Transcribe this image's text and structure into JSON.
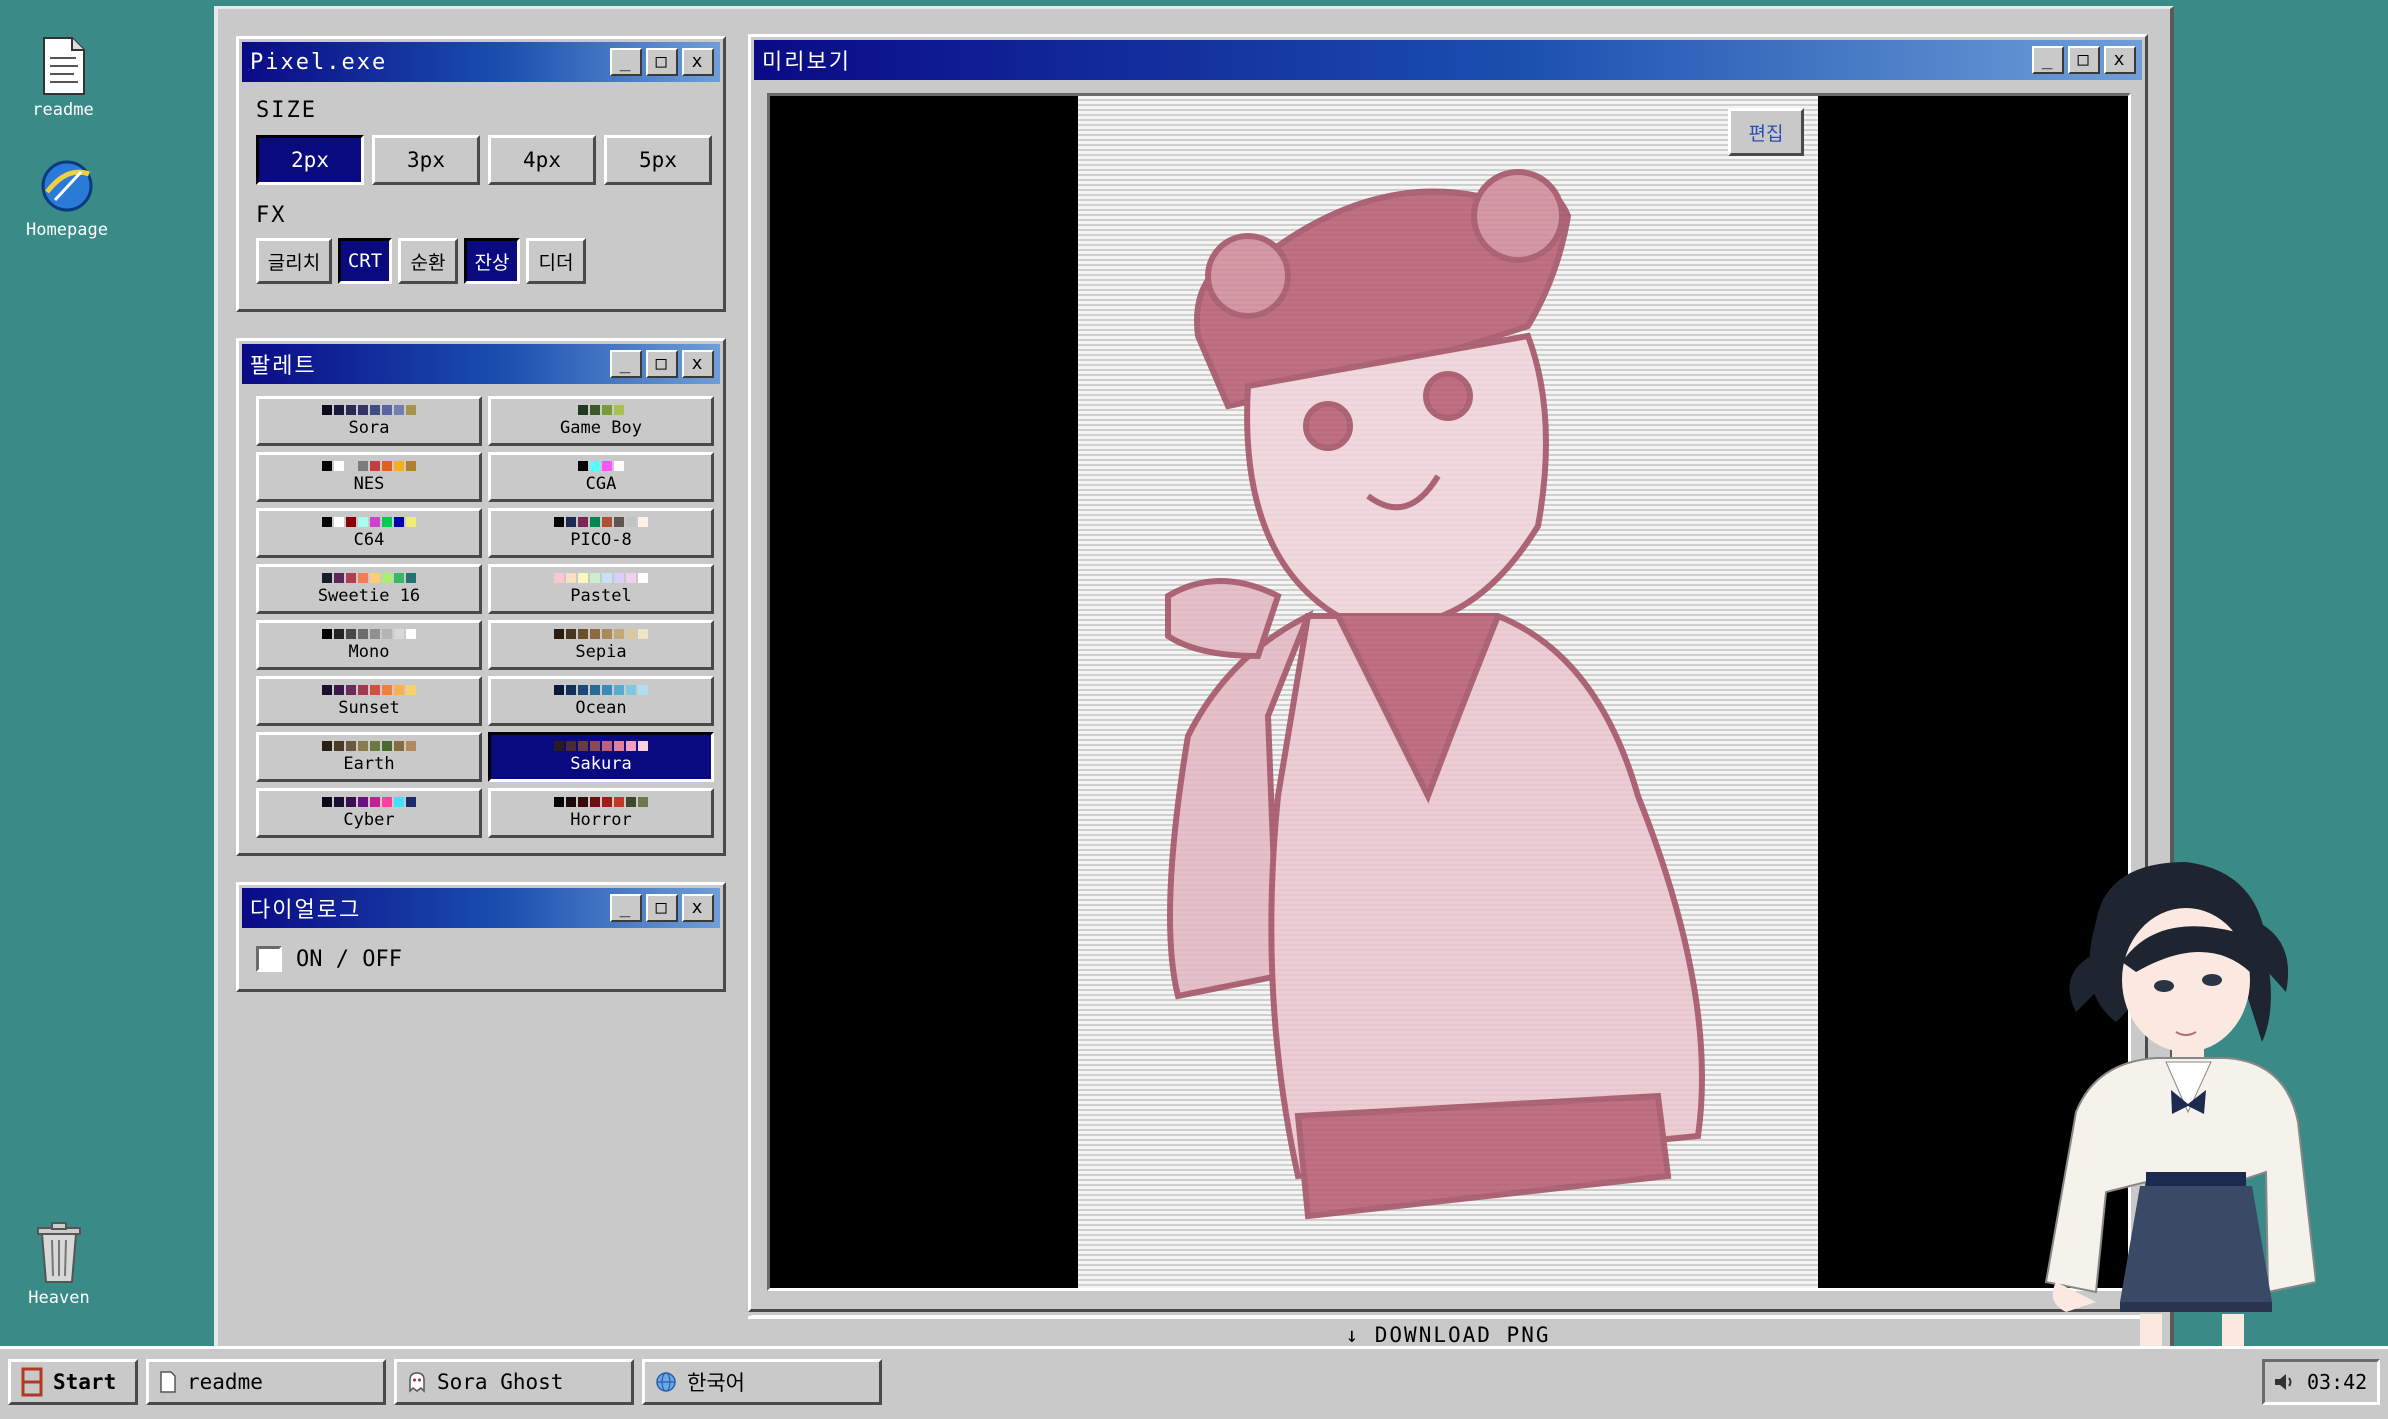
{
  "desktop": {
    "icons": [
      {
        "label": "readme",
        "icon": "document-icon"
      },
      {
        "label": "Homepage",
        "icon": "browser-icon"
      },
      {
        "label": "Heaven",
        "icon": "trash-icon"
      }
    ]
  },
  "pixel_window": {
    "title": "Pixel.exe",
    "size_label": "SIZE",
    "sizes": [
      "2px",
      "3px",
      "4px",
      "5px"
    ],
    "selected_size": "2px",
    "fx_label": "FX",
    "fx": [
      {
        "label": "글리치",
        "active": false
      },
      {
        "label": "CRT",
        "active": true
      },
      {
        "label": "순환",
        "active": false
      },
      {
        "label": "잔상",
        "active": true
      },
      {
        "label": "디더",
        "active": false
      }
    ]
  },
  "palette_window": {
    "title": "팔레트",
    "selected": "Sakura",
    "palettes": [
      {
        "name": "Sora",
        "colors": [
          "#0b0b1e",
          "#1a1a3a",
          "#2a2a55",
          "#34346a",
          "#3f4f86",
          "#5566a0",
          "#7080b0",
          "#a89250"
        ]
      },
      {
        "name": "Game Boy",
        "colors": [
          "#1f3a1f",
          "#3a5a2a",
          "#7a9a3a",
          "#a8c050"
        ]
      },
      {
        "name": "NES",
        "colors": [
          "#000000",
          "#ffffff",
          "#c9c9c9",
          "#7c7c7c",
          "#c04040",
          "#e06020",
          "#f0b020",
          "#b08030"
        ]
      },
      {
        "name": "CGA",
        "colors": [
          "#000000",
          "#55ffff",
          "#ff55ff",
          "#ffffff"
        ]
      },
      {
        "name": "C64",
        "colors": [
          "#000000",
          "#ffffff",
          "#880000",
          "#aaffee",
          "#cc44cc",
          "#00cc55",
          "#0000aa",
          "#eeee77"
        ]
      },
      {
        "name": "PICO-8",
        "colors": [
          "#000000",
          "#1d2b53",
          "#7e2553",
          "#008751",
          "#ab5236",
          "#5f574f",
          "#c2c3c7",
          "#fff1e8"
        ]
      },
      {
        "name": "Sweetie 16",
        "colors": [
          "#1a1c2c",
          "#5d275d",
          "#b13e53",
          "#ef7d57",
          "#ffcd75",
          "#a7f070",
          "#38b764",
          "#257179"
        ]
      },
      {
        "name": "Pastel",
        "colors": [
          "#f8c8d0",
          "#f8e0c0",
          "#f8f8c0",
          "#c8f0d0",
          "#c8e0f8",
          "#d8d0f8",
          "#f0d0f0",
          "#ffffff"
        ]
      },
      {
        "name": "Mono",
        "colors": [
          "#000000",
          "#242424",
          "#484848",
          "#6c6c6c",
          "#909090",
          "#b4b4b4",
          "#d8d8d8",
          "#ffffff"
        ]
      },
      {
        "name": "Sepia",
        "colors": [
          "#2b1d0e",
          "#4a3520",
          "#6b4f2e",
          "#8c6b40",
          "#a88a5c",
          "#c4a87a",
          "#dcc8a0",
          "#f0e4c8"
        ]
      },
      {
        "name": "Sunset",
        "colors": [
          "#1a1030",
          "#3a1a4a",
          "#6a2a5a",
          "#a03a50",
          "#d05040",
          "#f08040",
          "#f8b050",
          "#f8d070"
        ]
      },
      {
        "name": "Ocean",
        "colors": [
          "#0a1a3a",
          "#12305a",
          "#1a4a7a",
          "#2a6a9a",
          "#3a8aba",
          "#5aaad0",
          "#80c8e0",
          "#b0e0f0"
        ]
      },
      {
        "name": "Earth",
        "colors": [
          "#2a2016",
          "#4a3a26",
          "#6a5a3a",
          "#8a7a50",
          "#6a7a40",
          "#4a6a30",
          "#8a6a40",
          "#b08a5a"
        ]
      },
      {
        "name": "Sakura",
        "colors": [
          "#2a1a22",
          "#4a2a3a",
          "#6a3a4a",
          "#8a4a5a",
          "#c06080",
          "#e080a0",
          "#f0a0c0",
          "#f8d0e0"
        ]
      },
      {
        "name": "Cyber",
        "colors": [
          "#0a0a1a",
          "#1a1030",
          "#3a1050",
          "#6a1080",
          "#c02090",
          "#ff40a0",
          "#40e0ff",
          "#1a2a6a"
        ]
      },
      {
        "name": "Horror",
        "colors": [
          "#000000",
          "#1a0a0a",
          "#3a0a0a",
          "#6a1010",
          "#a01a1a",
          "#c03a2a",
          "#3a4a2a",
          "#6a7a4a"
        ]
      }
    ]
  },
  "dialog_window": {
    "title": "다이얼로그",
    "toggle_label": "ON / OFF",
    "checked": false
  },
  "preview_window": {
    "title": "미리보기",
    "edit_label": "편집",
    "download_label": "↓ DOWNLOAD PNG",
    "image_desc": "pink-tinted-pixel-art-character"
  },
  "taskbar": {
    "start_label": "Start",
    "items": [
      {
        "label": "readme",
        "icon": "document-icon"
      },
      {
        "label": "Sora Ghost",
        "icon": "ghost-icon"
      },
      {
        "label": "한국어",
        "icon": "globe-icon"
      }
    ],
    "clock": "03:42"
  },
  "colors": {
    "desktop": "#3a8a88",
    "accent": "#0a0a80",
    "preview_tint": "#c06a7a"
  }
}
